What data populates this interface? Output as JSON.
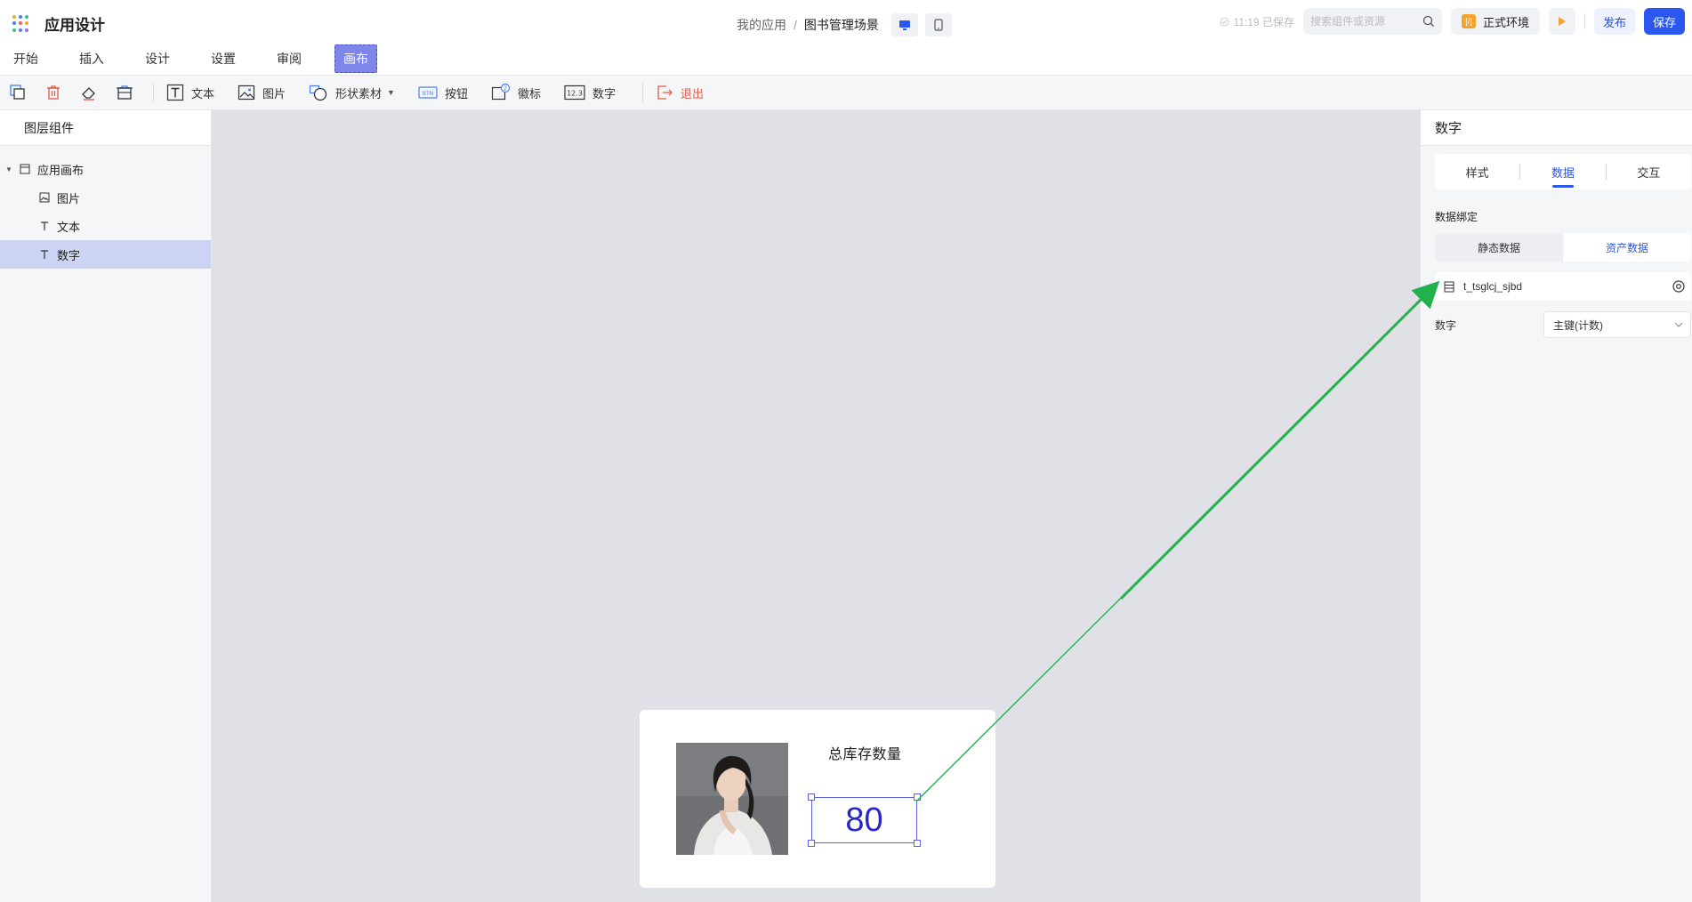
{
  "app": {
    "title": "应用设计"
  },
  "breadcrumb": {
    "root": "我的应用",
    "separator": "/",
    "current": "图书管理场景"
  },
  "header": {
    "saved_status": "11:19 已保存",
    "search_placeholder": "搜索组件或资源",
    "env_label": "正式环境",
    "publish_label": "发布",
    "save_label": "保存"
  },
  "menu": [
    "开始",
    "插入",
    "设计",
    "设置",
    "审阅",
    "画布"
  ],
  "toolbar": {
    "text": "文本",
    "image": "图片",
    "shape": "形状素材",
    "button": "按钮",
    "badge": "徽标",
    "number": "数字",
    "exit": "退出"
  },
  "layers": {
    "title": "图层组件",
    "root": "应用画布",
    "children": [
      "图片",
      "文本",
      "数字"
    ]
  },
  "card": {
    "title": "总库存数量",
    "value": "80"
  },
  "props": {
    "title": "数字",
    "tabs": [
      "样式",
      "数据",
      "交互"
    ],
    "binding_label": "数据绑定",
    "source_options": [
      "静态数据",
      "资产数据"
    ],
    "datasource_name": "t_tsglcj_sjbd",
    "field_label": "数字",
    "field_value": "主键(计数)"
  },
  "colors": {
    "accent": "#2b56f0",
    "canvas_tab": "#7f86ea",
    "arrow": "#21b24b",
    "number": "#2727c9"
  }
}
